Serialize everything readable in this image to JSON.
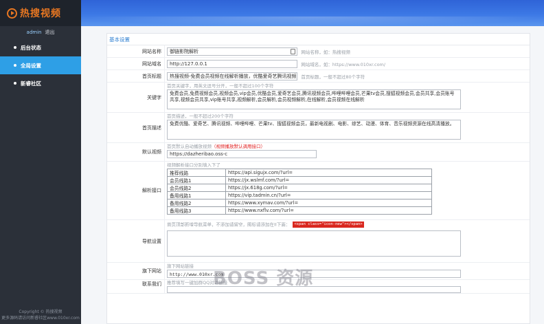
{
  "app": {
    "logo_text": "热搜视频",
    "username": "admin",
    "logout": "退出",
    "footer_line1": "Copyright © 热搜视频",
    "footer_line2": "更多源码请访问新睿社区www.010xr.com"
  },
  "sidebar": {
    "items": [
      {
        "label": "后台状态",
        "active": false
      },
      {
        "label": "全局设置",
        "active": true
      },
      {
        "label": "新睿社区",
        "active": false
      }
    ]
  },
  "section": {
    "title": "基本设置"
  },
  "form": {
    "site_name": {
      "label": "网站名称",
      "value": "御链影院解析",
      "hint": "网站名称，如：热搜视频"
    },
    "site_domain": {
      "label": "网站域名",
      "value": "http://127.0.0.1",
      "hint": "网站域名，如：https://www.010xr.com/"
    },
    "home_title": {
      "label": "首页标题",
      "value": "热搜视频-免费会员视频在线解析播放，优酷爱奇艺腾讯视频",
      "hint": "首页标题，一般不超过80个字符"
    },
    "keywords": {
      "label": "关键字",
      "hint": "首页关键字，用英文逗号分开，一般不超过100个字符",
      "value": "免费会员,免费视频会员,视频会员,vip会员,优酷会员,爱奇艺会员,腾讯视频会员,哔哩哔哩会员,芒果tv会员,搜狐视频会员,会员共享,会员账号共享,视频会员共享,vip账号共享,视频解析,会员解析,会员视频解析,在线解析,会员视频在线解析"
    },
    "description": {
      "label": "首页描述",
      "hint": "首页描述，一般不超过200个字符",
      "value": "免费优酷、爱奇艺、腾讯视频、哔哩哔哩、芒果tv、搜狐视频会员，最新电视剧、电影、综艺、动漫、体育、音乐视频资源在线高清播放。"
    },
    "default_video": {
      "label": "默认视频",
      "hint": "首页默认自动播放视频",
      "hint_red": "（视频播放默认调用接口）",
      "value": "https://dazheribao.oss-c"
    },
    "parse_api": {
      "label": "解析接口",
      "hint": "视频解析接口分别填入下了",
      "rows": [
        {
          "name": "推荐线路",
          "url": "https://api.sigujx.com/?url="
        },
        {
          "name": "会员线路1",
          "url": "https://jx.wslmf.com/?url="
        },
        {
          "name": "会员线路2",
          "url": "https://jx.618g.com/?url="
        },
        {
          "name": "备用线路1",
          "url": "https://vip.tadmin.cn/?url="
        },
        {
          "name": "备用线路2",
          "url": "https://www.xymav.com/?url="
        },
        {
          "name": "备用线路3",
          "url": "https://www.nxflv.com/?url="
        }
      ]
    },
    "nav": {
      "label": "导航设置",
      "hint": "首页顶部新增导航菜单，不添加请留空，图标请添加在II下面：",
      "code": "<span class=\"icon-new\"></span>"
    },
    "sub_site": {
      "label": "旗下网站",
      "hint": "旗下网站链接",
      "value": "http://www.010xr.com"
    },
    "contact": {
      "label": "联系我们",
      "hint": "推荐填写一键加群QQ对话链接"
    }
  },
  "watermark": "BOSS 资源"
}
